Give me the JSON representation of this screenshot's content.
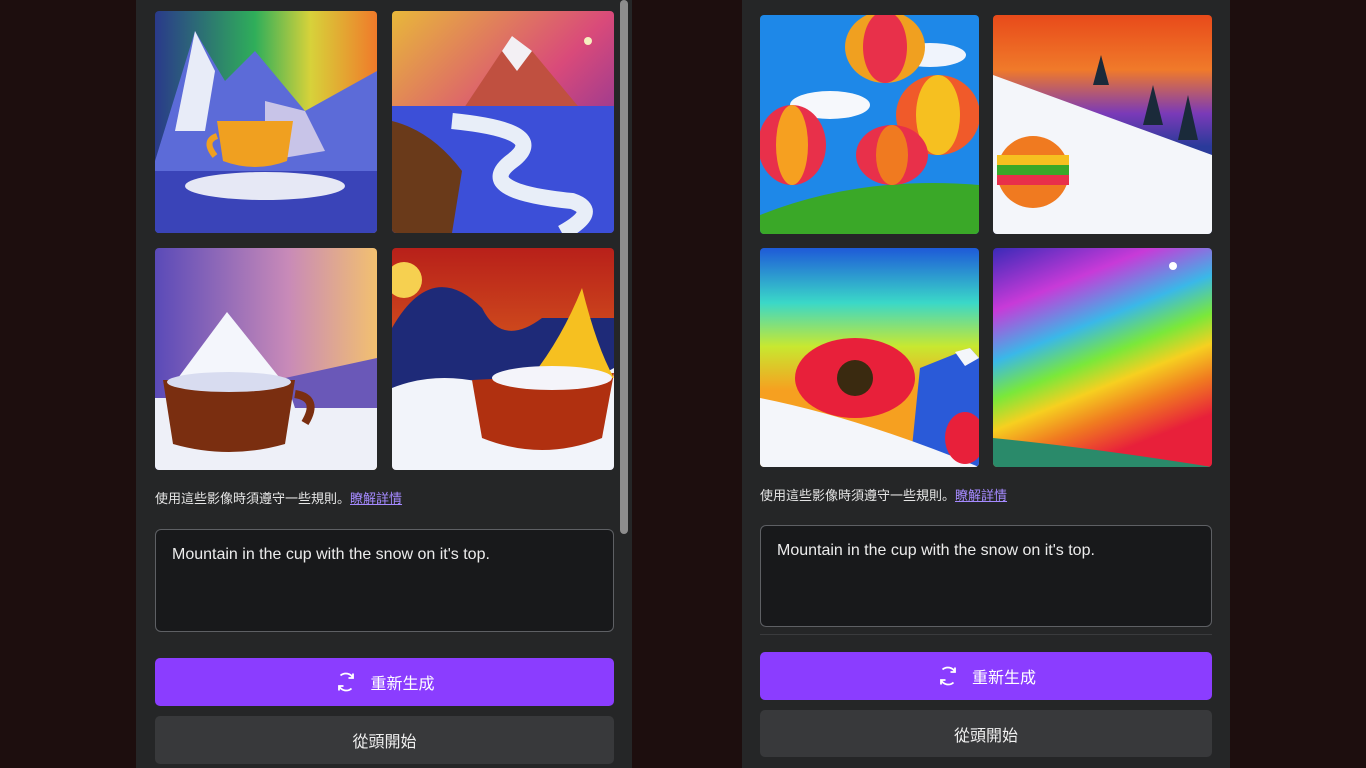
{
  "left_panel": {
    "images": [
      {
        "name": "snow-mountain-cup-image"
      },
      {
        "name": "mountain-river-image"
      },
      {
        "name": "cup-snow-peak-image"
      },
      {
        "name": "snow-cup-sunset-image"
      }
    ],
    "rules_text": "使用這些影像時須遵守一些規則。",
    "rules_link": "瞭解詳情",
    "prompt": "Mountain in the cup with the snow on it's top.",
    "regenerate_label": "重新生成",
    "start_over_label": "從頭開始"
  },
  "right_panel": {
    "images": [
      {
        "name": "hot-air-balloons-image"
      },
      {
        "name": "snowy-slope-balloon-image"
      },
      {
        "name": "red-flower-snow-image"
      },
      {
        "name": "rainbow-sky-image"
      }
    ],
    "rules_text": "使用這些影像時須遵守一些規則。",
    "rules_link": "瞭解詳情",
    "prompt": "Mountain in the cup with the snow on it's top.",
    "regenerate_label": "重新生成",
    "start_over_label": "從頭開始"
  },
  "colors": {
    "accent": "#8b3dff",
    "link": "#a58aff",
    "panel_bg": "#252627",
    "page_bg": "#1d0e0e"
  },
  "icons": {
    "regenerate": "refresh-icon"
  }
}
